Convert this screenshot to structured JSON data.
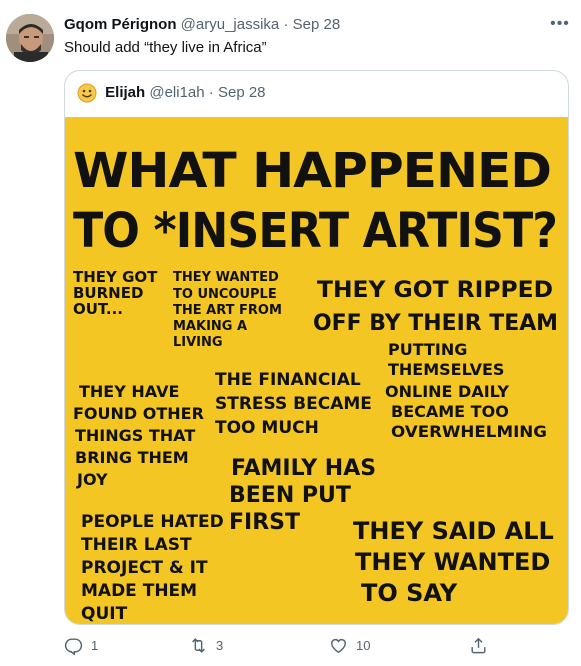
{
  "tweet": {
    "author_name": "Gqom Pérignon",
    "handle": "@aryu_jassika",
    "separator": "·",
    "date": "Sep 28",
    "text": "Should add “they live in Africa”",
    "more_icon": "more-icon"
  },
  "quoted": {
    "author_name": "Elijah",
    "handle": "@eli1ah",
    "separator": "·",
    "date": "Sep 28",
    "emoji_icon": "smiley-emoji",
    "poster": {
      "title_line1": "WHAT HAPPENED",
      "title_line2": "TO *INSERT ARTIST?",
      "reasons": [
        [
          "THEY GOT",
          "BURNED",
          "OUT..."
        ],
        [
          "THEY WANTED",
          "TO UNCOUPLE",
          "THE ART FROM",
          "MAKING A",
          "LIVING"
        ],
        [
          "THEY GOT RIPPED",
          "OFF BY THEIR TEAM"
        ],
        [
          "PUTTING",
          "THEMSELVES",
          "ONLINE DAILY",
          "BECAME TOO",
          "OVERWHELMING"
        ],
        [
          "THEY HAVE",
          "FOUND OTHER",
          "THINGS THAT",
          "BRING THEM",
          "JOY"
        ],
        [
          "THE FINANCIAL",
          "STRESS BECAME",
          "TOO MUCH"
        ],
        [
          "FAMILY HAS",
          "BEEN PUT",
          "FIRST"
        ],
        [
          "PEOPLE HATED",
          "THEIR LAST",
          "PROJECT & IT",
          "MADE THEM",
          "QUIT"
        ],
        [
          "THEY SAID ALL",
          "THEY WANTED",
          "TO SAY"
        ]
      ],
      "background_color": "#f3c623"
    }
  },
  "actions": {
    "reply": {
      "icon": "reply-icon",
      "count": "1"
    },
    "retweet": {
      "icon": "retweet-icon",
      "count": "3"
    },
    "like": {
      "icon": "heart-icon",
      "count": "10"
    },
    "share": {
      "icon": "share-icon"
    }
  }
}
